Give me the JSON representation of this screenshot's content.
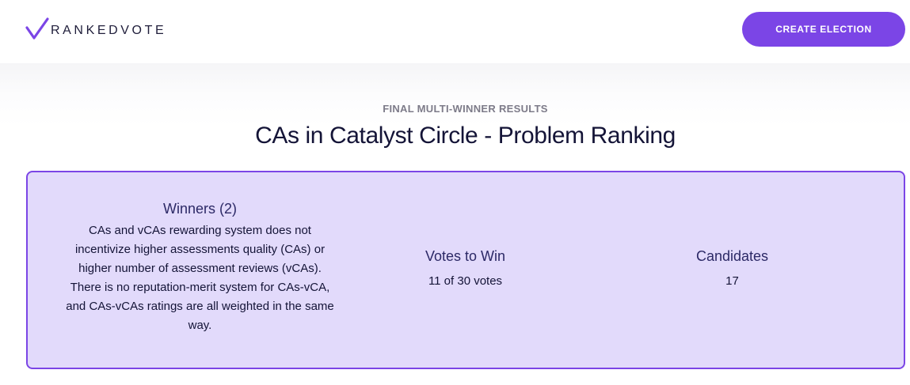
{
  "header": {
    "logo_text": "RANKEDVOTE",
    "logo_icon": "check-mark-icon",
    "create_button_label": "CREATE ELECTION"
  },
  "results": {
    "subtitle": "FINAL MULTI-WINNER RESULTS",
    "title": "CAs in Catalyst Circle - Problem Ranking",
    "winners_heading": "Winners (2)",
    "winners_text": "CAs and vCAs rewarding system does not incentivize higher assessments quality (CAs) or higher number of assessment reviews (vCAs). There is no reputation-merit system for CAs-vCA, and CAs-vCAs ratings are all weighted in the same way.",
    "votes_heading": "Votes to Win",
    "votes_value": "11 of 30 votes",
    "candidates_heading": "Candidates",
    "candidates_value": "17"
  },
  "colors": {
    "accent": "#7b45e6",
    "panel_bg": "#e2dafb",
    "heading": "#2c2966",
    "text": "#141437"
  }
}
